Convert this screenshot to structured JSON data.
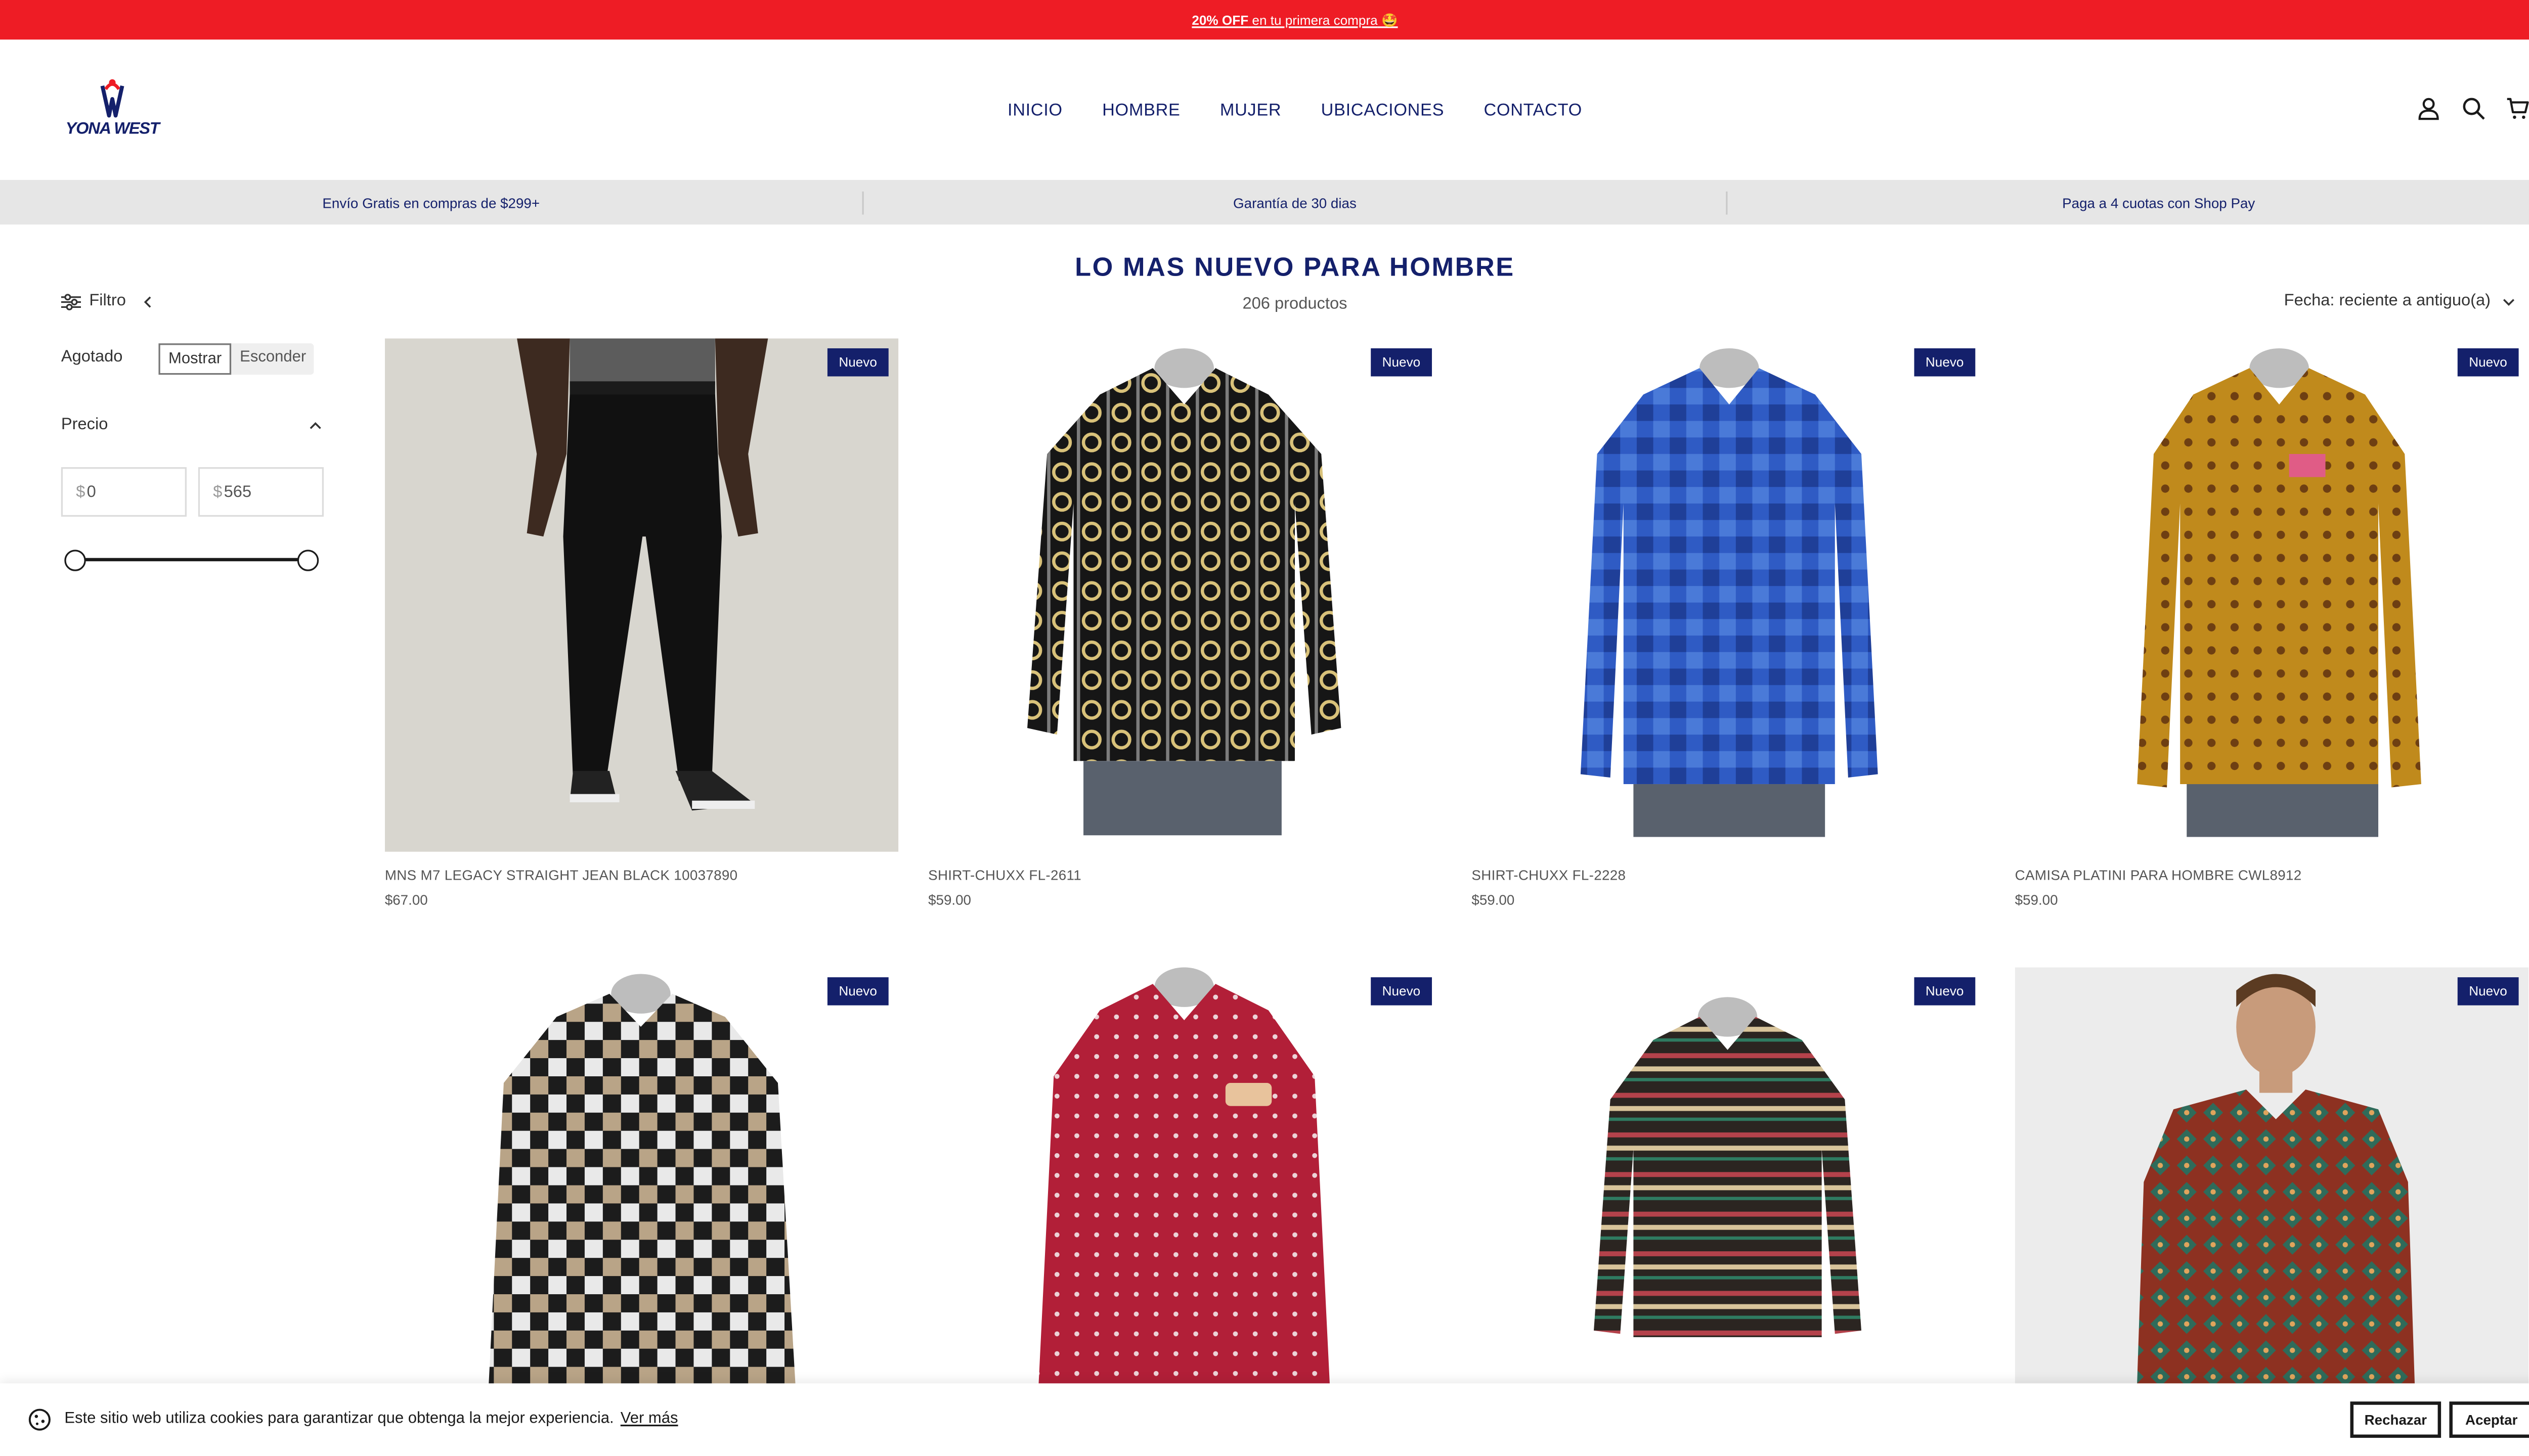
{
  "announcement": {
    "bold": "20% OFF",
    "rest": " en tu primera compra",
    "emoji": "🤩"
  },
  "brand": {
    "name": "YONA WEST"
  },
  "nav": [
    "INICIO",
    "HOMBRE",
    "MUJER",
    "UBICACIONES",
    "CONTACTO"
  ],
  "header_icons": [
    "account-icon",
    "search-icon",
    "cart-icon"
  ],
  "usp": [
    "Envío Gratis en compras de $299+",
    "Garantía de 30 dias",
    "Paga a 4 cuotas con Shop Pay"
  ],
  "collection": {
    "title": "LO MAS NUEVO PARA HOMBRE",
    "count": "206 productos"
  },
  "filter": {
    "toggle_label": "Filtro",
    "sold_out_label": "Agotado",
    "show_label": "Mostrar",
    "hide_label": "Esconder",
    "price_label": "Precio",
    "currency": "$",
    "min_price": "0",
    "max_price": "565"
  },
  "sort": {
    "label": "Fecha: reciente a antiguo(a)"
  },
  "badge_label": "Nuevo",
  "products": [
    {
      "name": "MNS M7 LEGACY STRAIGHT JEAN BLACK 10037890",
      "price": "$67.00"
    },
    {
      "name": "SHIRT-CHUXX FL-2611",
      "price": "$59.00"
    },
    {
      "name": "SHIRT-CHUXX FL-2228",
      "price": "$59.00"
    },
    {
      "name": "CAMISA PLATINI PARA HOMBRE CWL8912",
      "price": "$59.00"
    },
    {
      "name": "",
      "price": ""
    },
    {
      "name": "",
      "price": ""
    },
    {
      "name": "",
      "price": ""
    },
    {
      "name": "",
      "price": ""
    }
  ],
  "cookie": {
    "text": "Este sitio web utiliza cookies para garantizar que obtenga la mejor experiencia.",
    "link": "Ver más",
    "reject": "Rechazar",
    "accept": "Aceptar"
  },
  "colors": {
    "announcement_bg": "#ee1c25",
    "brand_navy": "#14206b",
    "usp_bg": "#e6e6e6",
    "whatsapp": "#25d366"
  }
}
